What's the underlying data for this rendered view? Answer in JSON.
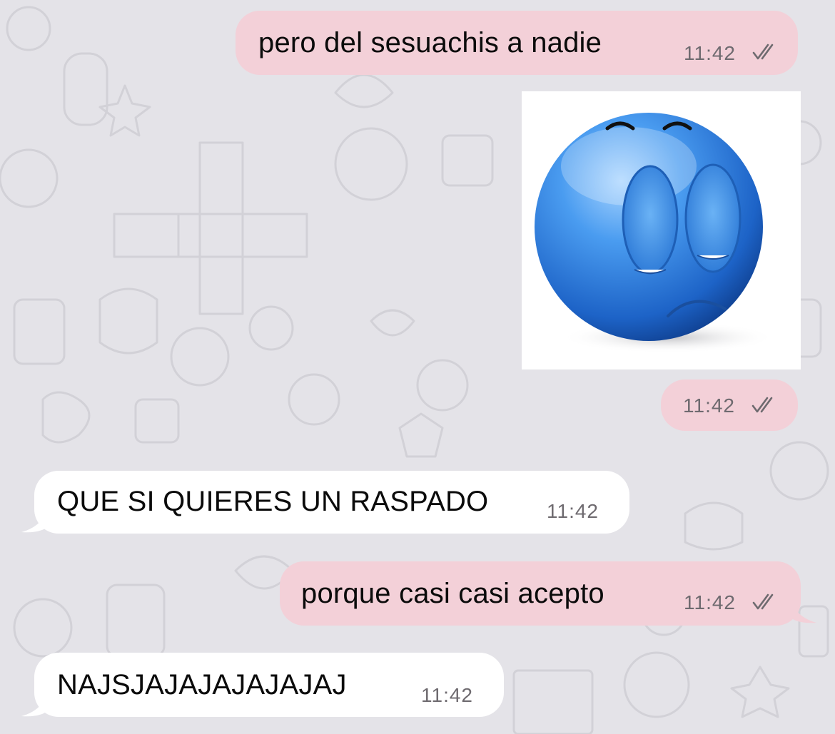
{
  "chat": {
    "messages": [
      {
        "direction": "outgoing",
        "type": "text",
        "text": "pero del sesuachis a nadie",
        "time": "11:42",
        "status": "read"
      },
      {
        "direction": "outgoing",
        "type": "image",
        "image": "blue-sad-emoji-sticker",
        "time": "11:42",
        "status": "read"
      },
      {
        "direction": "incoming",
        "type": "text",
        "text": "QUE SI QUIERES UN RASPADO",
        "time": "11:42"
      },
      {
        "direction": "outgoing",
        "type": "text",
        "text": "porque casi casi acepto",
        "time": "11:42",
        "status": "read"
      },
      {
        "direction": "incoming",
        "type": "text",
        "text": "NAJSJAJAJAJAJAJAJ",
        "time": "11:42"
      }
    ]
  },
  "colors": {
    "background": "#e4e3e8",
    "outgoing_bubble": "#f3d0d8",
    "incoming_bubble": "#ffffff",
    "text": "#0b0b0b",
    "meta": "#6e6a6f",
    "emoji_blue": "#3a8ee6"
  },
  "icons": {
    "read_receipt": "double-check-icon",
    "wallpaper": "doodle-pattern"
  }
}
